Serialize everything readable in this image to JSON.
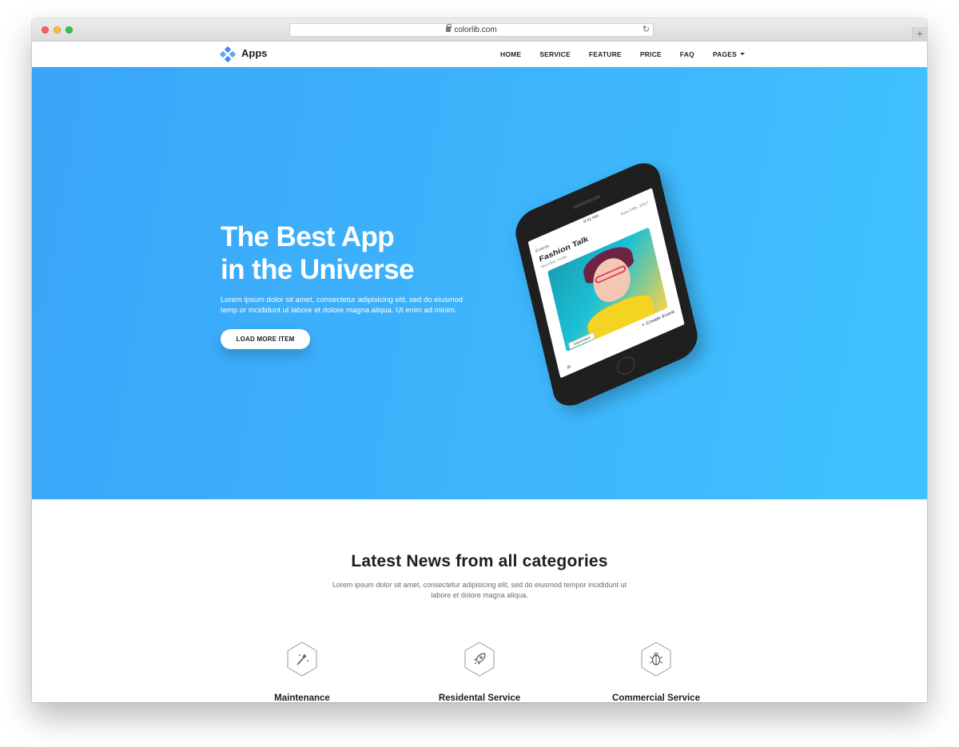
{
  "browser": {
    "url": "colorlib.com",
    "newtab_label": "+"
  },
  "nav": {
    "brand": "Apps",
    "items": [
      "HOME",
      "SERVICE",
      "FEATURE",
      "PRICE",
      "FAQ",
      "PAGES"
    ]
  },
  "hero": {
    "title_line1": "The Best App",
    "title_line2": "in the Universe",
    "text": "Lorem ipsum dolor sit amet, consectetur adipisicing elit, sed do eiusmod temp or incididunt ut labore et dolore magna aliqua. Ut enim ad minim.",
    "button": "LOAD MORE ITEM"
  },
  "phone_screen": {
    "time": "9:41 AM",
    "back_label": "Events",
    "date": "Nov 24th, 2017",
    "title": "Fashion Talk",
    "subtitle": "Mumbai, India",
    "badge": "Interested",
    "create": "+ Create Event"
  },
  "news": {
    "title": "Latest News from all categories",
    "text": "Lorem ipsum dolor sit amet, consectetur adipisicing elit, sed do eiusmod tempor incididunt ut labore et dolore magna aliqua."
  },
  "services": [
    {
      "label": "Maintenance",
      "icon": "magic-wand-icon"
    },
    {
      "label": "Residental Service",
      "icon": "rocket-icon"
    },
    {
      "label": "Commercial Service",
      "icon": "bug-icon"
    }
  ],
  "colors": {
    "hero_start": "#3aa5f8",
    "hero_end": "#40c2ff",
    "brand_accent": "#3f8df5"
  }
}
